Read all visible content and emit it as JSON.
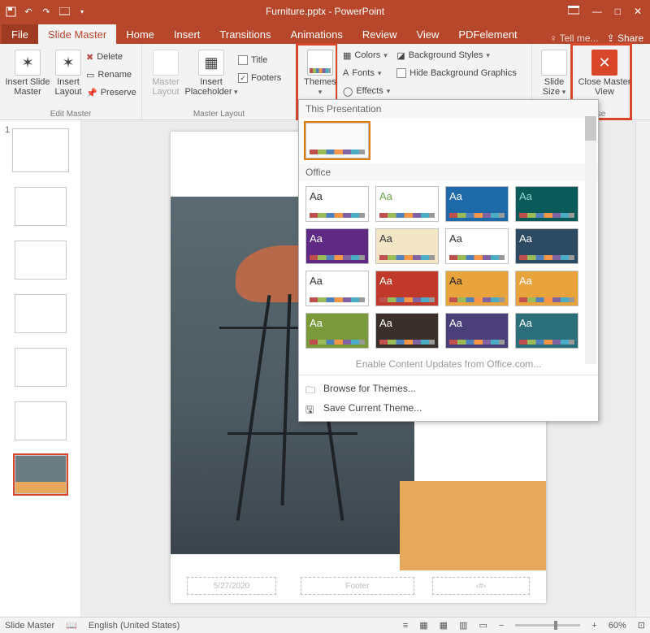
{
  "app_name": "PowerPoint",
  "doc_name": "Furniture.pptx",
  "tabs": {
    "file": "File",
    "slide_master": "Slide Master",
    "home": "Home",
    "insert": "Insert",
    "transitions": "Transitions",
    "animations": "Animations",
    "review": "Review",
    "view": "View",
    "pdfelement": "PDFelement",
    "tell_me": "Tell me...",
    "share": "Share"
  },
  "ribbon": {
    "insert_slide_master": "Insert Slide Master",
    "insert_layout": "Insert Layout",
    "delete": "Delete",
    "rename": "Rename",
    "preserve": "Preserve",
    "edit_master_group": "Edit Master",
    "master_layout": "Master Layout",
    "insert_placeholder": "Insert Placeholder",
    "title_chk": "Title",
    "footers_chk": "Footers",
    "master_layout_group": "Master Layout",
    "themes": "Themes",
    "colors": "Colors",
    "fonts": "Fonts",
    "effects": "Effects",
    "bg_styles": "Background Styles",
    "hide_bg": "Hide Background Graphics",
    "slide_size": "Slide Size",
    "size_group": "Size",
    "close_master": "Close Master View",
    "close_group": "se"
  },
  "themes_dropdown": {
    "this_presentation": "This Presentation",
    "office": "Office",
    "enable_updates": "Enable Content Updates from Office.com...",
    "browse": "Browse for Themes...",
    "save_current": "Save Current Theme...",
    "thumbs": [
      {
        "aa": "Aa",
        "bg": "#ffffff",
        "fg": "#333"
      },
      {
        "aa": "Aa",
        "bg": "#ffffff",
        "fg": "#6da34d"
      },
      {
        "aa": "Aa",
        "bg": "#1e6aa8",
        "fg": "#fff",
        "pattern": true
      },
      {
        "aa": "Aa",
        "bg": "#0b5a5a",
        "fg": "#8fd9d1"
      },
      {
        "aa": "Aa",
        "bg": "#5e2a84",
        "fg": "#fff"
      },
      {
        "aa": "Aa",
        "bg": "#f3e6c6",
        "fg": "#333"
      },
      {
        "aa": "Aa",
        "bg": "#ffffff",
        "fg": "#333"
      },
      {
        "aa": "Aa",
        "bg": "#2d4a63",
        "fg": "#fff"
      },
      {
        "aa": "Aa",
        "bg": "#ffffff",
        "fg": "#333"
      },
      {
        "aa": "Aa",
        "bg": "#c0392b",
        "fg": "#fff"
      },
      {
        "aa": "Aa",
        "bg": "#e8a33d",
        "fg": "#222"
      },
      {
        "aa": "Aa",
        "bg": "#e8a33d",
        "fg": "#fff"
      },
      {
        "aa": "Aa",
        "bg": "#7a9a3b",
        "fg": "#fff"
      },
      {
        "aa": "Aa",
        "bg": "#3a2f2a",
        "fg": "#fff"
      },
      {
        "aa": "Aa",
        "bg": "#4a3f78",
        "fg": "#fff"
      },
      {
        "aa": "Aa",
        "bg": "#2a6f7a",
        "fg": "#fff"
      }
    ]
  },
  "slide": {
    "date": "5/27/2020",
    "footer": "Footer",
    "num": "‹#›"
  },
  "thumbs": {
    "master_index": "1"
  },
  "status": {
    "view": "Slide Master",
    "lang": "English (United States)",
    "zoom": "60%"
  }
}
